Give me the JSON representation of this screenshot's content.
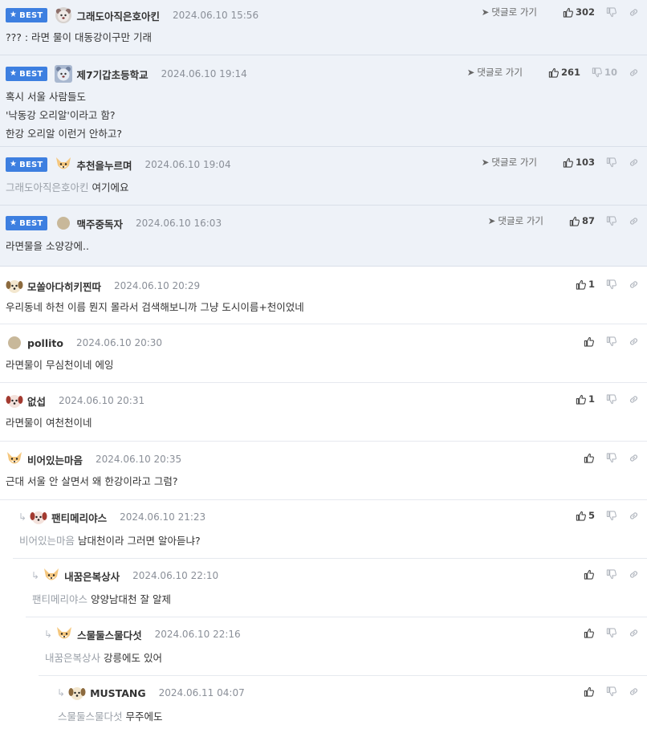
{
  "labels": {
    "best_badge": "BEST",
    "goto_reply": "댓글로 가기"
  },
  "best_comments": [
    {
      "nick": "그래도아직은호아킨",
      "date": "2024.06.10 15:56",
      "avatar": "gray-bear-icon",
      "lines": [
        "??? : 라면 물이 대동강이구만 기래"
      ],
      "likes": "302",
      "dislikes": ""
    },
    {
      "nick": "제7기갑초등학교",
      "date": "2024.06.10 19:14",
      "avatar": "blue-bear-icon",
      "lines": [
        "혹시 서울 사람들도",
        "'낙동강 오리알'이라고 함?",
        "한강 오리알 이런거 안하고?"
      ],
      "likes": "261",
      "dislikes": "10"
    },
    {
      "nick": "추천을누르며",
      "date": "2024.06.10 19:04",
      "avatar": "fox-icon",
      "mention": "그래도아직은호아킨",
      "lines": [
        "여기에요"
      ],
      "likes": "103",
      "dislikes": ""
    },
    {
      "nick": "맥주중독자",
      "date": "2024.06.10 16:03",
      "avatar": "default-dot-icon",
      "lines": [
        "라면물을 소양강에.."
      ],
      "likes": "87",
      "dislikes": ""
    }
  ],
  "comments": [
    {
      "nick": "모쏠아다히키찐따",
      "date": "2024.06.10 20:29",
      "avatar": "puppy-icon",
      "text": "우리동네 하천 이름 뭔지 몰라서 검색해보니까 그냥 도시이름+천이었네",
      "likes": "1"
    },
    {
      "nick": "pollito",
      "date": "2024.06.10 20:30",
      "avatar": "default-dot-icon",
      "text": "라면물이 무심천이네 에잉",
      "likes": ""
    },
    {
      "nick": "없섭",
      "date": "2024.06.10 20:31",
      "avatar": "red-puppy-icon",
      "text": "라면물이 여천천이네",
      "likes": "1"
    },
    {
      "nick": "비어있는마음",
      "date": "2024.06.10 20:35",
      "avatar": "fox-icon",
      "text": "근대 서울 안 살면서 왜 한강이라고 그럼?",
      "likes": ""
    }
  ],
  "replies": [
    {
      "nick": "팬티메리야스",
      "date": "2024.06.10 21:23",
      "avatar": "red-puppy-icon",
      "mention": "비어있는마음",
      "text": "남대천이라 그러면 알아듣냐?",
      "likes": "5"
    },
    {
      "nick": "내꿈은복상사",
      "date": "2024.06.10 22:10",
      "avatar": "fox-icon",
      "mention": "팬티메리야스",
      "text": "양양남대천 잘 알제",
      "likes": ""
    },
    {
      "nick": "스물둘스물다섯",
      "date": "2024.06.10 22:16",
      "avatar": "fox-icon",
      "mention": "내꿈은복상사",
      "text": "강릉에도 있어",
      "likes": ""
    },
    {
      "nick": "MUSTANG",
      "date": "2024.06.11 04:07",
      "avatar": "puppy-icon",
      "mention": "스물둘스물다섯",
      "text": "무주에도",
      "likes": ""
    }
  ]
}
